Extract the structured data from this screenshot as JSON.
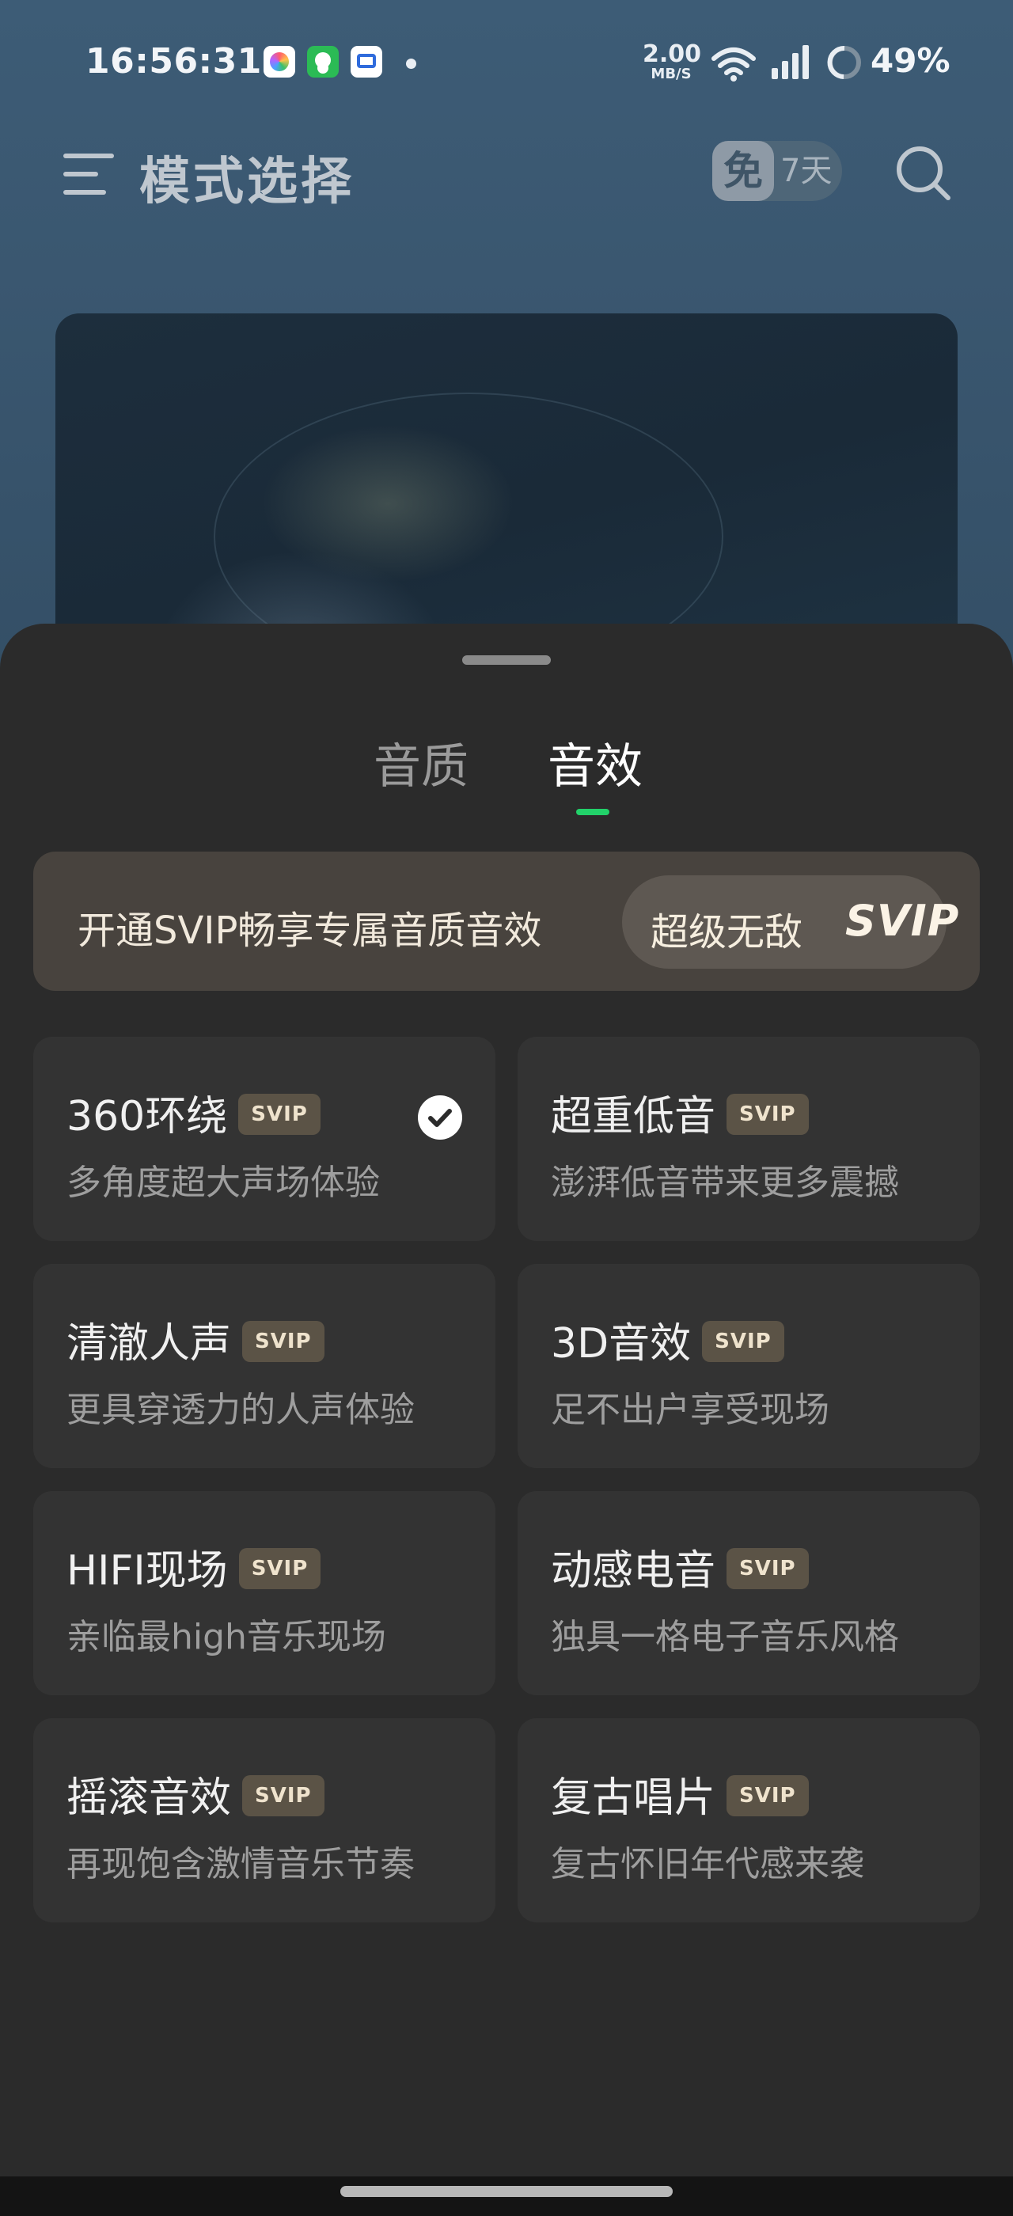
{
  "status_bar": {
    "time": "16:56:31",
    "net_speed_value": "2.00",
    "net_speed_unit": "MB/S",
    "battery": "49%"
  },
  "header": {
    "title": "模式选择",
    "free_badge_icon": "免",
    "free_badge_days": "7天"
  },
  "tabs": [
    {
      "label": "音质",
      "active": false
    },
    {
      "label": "音效",
      "active": true
    }
  ],
  "promo": {
    "text": "开通SVIP畅享专属音质音效",
    "button_label": "超级无敌",
    "button_svip": "SVIP"
  },
  "effects": [
    {
      "title": "360环绕",
      "badge": "SVIP",
      "desc": "多角度超大声场体验",
      "selected": true
    },
    {
      "title": "超重低音",
      "badge": "SVIP",
      "desc": "澎湃低音带来更多震撼",
      "selected": false
    },
    {
      "title": "清澈人声",
      "badge": "SVIP",
      "desc": "更具穿透力的人声体验",
      "selected": false
    },
    {
      "title": "3D音效",
      "badge": "SVIP",
      "desc": "足不出户享受现场",
      "selected": false
    },
    {
      "title": "HIFI现场",
      "badge": "SVIP",
      "desc": "亲临最high音乐现场",
      "selected": false
    },
    {
      "title": "动感电音",
      "badge": "SVIP",
      "desc": "独具一格电子音乐风格",
      "selected": false
    },
    {
      "title": "摇滚音效",
      "badge": "SVIP",
      "desc": "再现饱含激情音乐节奏",
      "selected": false
    },
    {
      "title": "复古唱片",
      "badge": "SVIP",
      "desc": "复古怀旧年代感来袭",
      "selected": false
    }
  ],
  "colors": {
    "accent": "#22d26a",
    "sheet_bg": "#2b2b2b",
    "card_bg": "#333333",
    "svip_tag_bg": "#5b5346"
  }
}
